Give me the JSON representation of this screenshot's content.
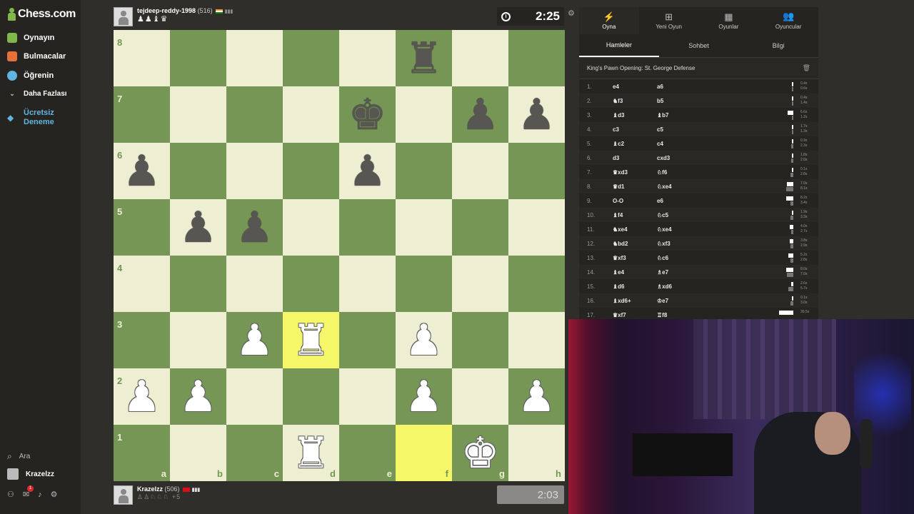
{
  "app": {
    "logo_text": "Chess.com"
  },
  "sidebar": {
    "items": [
      {
        "label": "Oynayın",
        "color": "#81b64c"
      },
      {
        "label": "Bulmacalar",
        "color": "#e8703a"
      },
      {
        "label": "Öğrenin",
        "color": "#5fb4e0"
      },
      {
        "label": "Daha Fazlası",
        "color": "#bbbbbb"
      },
      {
        "label": "Ücretsiz Deneme",
        "color": "#5fb4e0"
      }
    ],
    "search_label": "Ara",
    "user_label": "Krazelzz",
    "notification_count": "1"
  },
  "top_player": {
    "name": "tejdeep-reddy-1998",
    "rating": "(516)",
    "captured": "♟♟♝♛"
  },
  "bottom_player": {
    "name": "Krazelzz",
    "rating": "(506)",
    "captured": "♙♙♘♘♘ +5"
  },
  "clocks": {
    "top": "2:25",
    "bottom": "2:03"
  },
  "board": {
    "ranks": [
      "8",
      "7",
      "6",
      "5",
      "4",
      "3",
      "2",
      "1"
    ],
    "files": [
      "a",
      "b",
      "c",
      "d",
      "e",
      "f",
      "g",
      "h"
    ],
    "highlight": [
      "f1"
    ],
    "selected": [
      "d3"
    ],
    "pieces": [
      {
        "sq": "f8",
        "glyph": "♜",
        "color": "black"
      },
      {
        "sq": "e7",
        "glyph": "♚",
        "color": "black"
      },
      {
        "sq": "g7",
        "glyph": "♟",
        "color": "black"
      },
      {
        "sq": "h7",
        "glyph": "♟",
        "color": "black"
      },
      {
        "sq": "a6",
        "glyph": "♟",
        "color": "black"
      },
      {
        "sq": "e6",
        "glyph": "♟",
        "color": "black"
      },
      {
        "sq": "b5",
        "glyph": "♟",
        "color": "black"
      },
      {
        "sq": "c5",
        "glyph": "♟",
        "color": "black"
      },
      {
        "sq": "c3",
        "glyph": "♟",
        "color": "white"
      },
      {
        "sq": "d3",
        "glyph": "♜",
        "color": "white"
      },
      {
        "sq": "f3",
        "glyph": "♟",
        "color": "white"
      },
      {
        "sq": "a2",
        "glyph": "♟",
        "color": "white"
      },
      {
        "sq": "b2",
        "glyph": "♟",
        "color": "white"
      },
      {
        "sq": "f2",
        "glyph": "♟",
        "color": "white"
      },
      {
        "sq": "h2",
        "glyph": "♟",
        "color": "white"
      },
      {
        "sq": "d1",
        "glyph": "♜",
        "color": "white"
      },
      {
        "sq": "g1",
        "glyph": "♚",
        "color": "white"
      }
    ]
  },
  "panel": {
    "tabs": [
      {
        "label": "Oyna",
        "icon": "⚡"
      },
      {
        "label": "Yeni Oyun",
        "icon": "⊞"
      },
      {
        "label": "Oyunlar",
        "icon": "▦"
      },
      {
        "label": "Oyuncular",
        "icon": "👥"
      }
    ],
    "subtabs": [
      "Hamleler",
      "Sohbet",
      "Bilgi"
    ],
    "opening": "King's Pawn Opening: St. George Defense",
    "moves": [
      {
        "n": "1.",
        "w": "e4",
        "b": "a6",
        "wt": "0.4s",
        "bt": "0.6s",
        "ww": 0.05,
        "bw": 0.05
      },
      {
        "n": "2.",
        "w": "♞f3",
        "b": "b5",
        "wt": "0.4s",
        "bt": "1.4s",
        "ww": 0.05,
        "bw": 0.1
      },
      {
        "n": "3.",
        "w": "♝d3",
        "b": "♝b7",
        "wt": "6.6s",
        "bt": "1.2s",
        "ww": 0.4,
        "bw": 0.1
      },
      {
        "n": "4.",
        "w": "c3",
        "b": "c5",
        "wt": "1.7s",
        "bt": "1.3s",
        "ww": 0.12,
        "bw": 0.1
      },
      {
        "n": "5.",
        "w": "♝c2",
        "b": "c4",
        "wt": "0.9s",
        "bt": "2.3s",
        "ww": 0.07,
        "bw": 0.15
      },
      {
        "n": "6.",
        "w": "d3",
        "b": "cxd3",
        "wt": "1.8s",
        "bt": "2.0s",
        "ww": 0.12,
        "bw": 0.13
      },
      {
        "n": "7.",
        "w": "♛xd3",
        "b": "♘f6",
        "wt": "0.1s",
        "bt": "2.8s",
        "ww": 0.02,
        "bw": 0.18
      },
      {
        "n": "8.",
        "w": "♛d1",
        "b": "♘xe4",
        "wt": "7.0s",
        "bt": "8.1s",
        "ww": 0.45,
        "bw": 0.5
      },
      {
        "n": "9.",
        "w": "O-O",
        "b": "e6",
        "wt": "8.2s",
        "bt": "3.4s",
        "ww": 0.5,
        "bw": 0.2
      },
      {
        "n": "10.",
        "w": "♝f4",
        "b": "♘c5",
        "wt": "1.9s",
        "bt": "3.3s",
        "ww": 0.12,
        "bw": 0.2
      },
      {
        "n": "11.",
        "w": "♞xe4",
        "b": "♘xe4",
        "wt": "4.0s",
        "bt": "2.7s",
        "ww": 0.25,
        "bw": 0.17
      },
      {
        "n": "12.",
        "w": "♞bd2",
        "b": "♘xf3",
        "wt": "3.8s",
        "bt": "2.9s",
        "ww": 0.24,
        "bw": 0.18
      },
      {
        "n": "13.",
        "w": "♛xf3",
        "b": "♘c6",
        "wt": "5.2s",
        "bt": "2.8s",
        "ww": 0.33,
        "bw": 0.18
      },
      {
        "n": "14.",
        "w": "♝e4",
        "b": "♗e7",
        "wt": "8.0s",
        "bt": "7.0s",
        "ww": 0.5,
        "bw": 0.45
      },
      {
        "n": "15.",
        "w": "♝d6",
        "b": "♗xd6",
        "wt": "2.6s",
        "bt": "5.7s",
        "ww": 0.16,
        "bw": 0.36
      },
      {
        "n": "16.",
        "w": "♝xd6+",
        "b": "♔e7",
        "wt": "0.1s",
        "bt": "3.0s",
        "ww": 0.02,
        "bw": 0.19
      },
      {
        "n": "17.",
        "w": "♛xf7",
        "b": "♖f8",
        "wt": "30.5s",
        "bt": "",
        "ww": 1.0,
        "bw": 0
      }
    ]
  }
}
